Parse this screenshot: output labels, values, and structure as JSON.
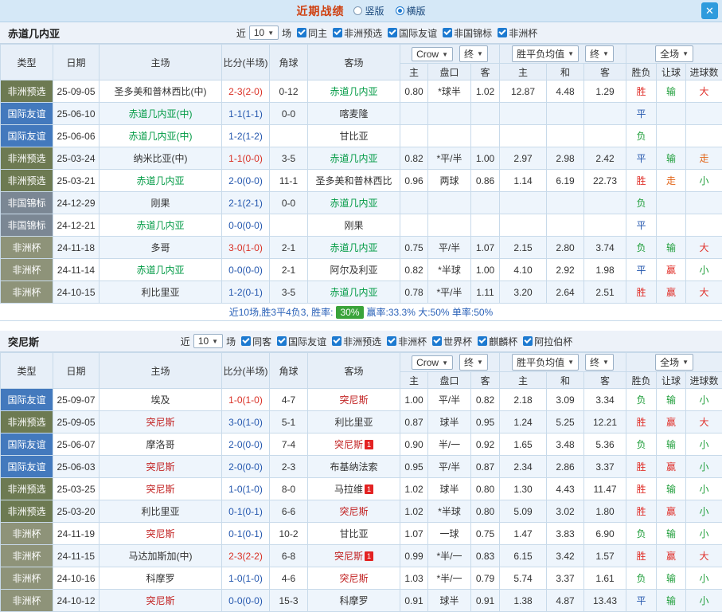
{
  "titlebar": {
    "title": "近期战绩",
    "radios": [
      {
        "label": "竖版",
        "selected": false
      },
      {
        "label": "横版",
        "selected": true
      }
    ],
    "close_icon": "✕"
  },
  "table_headers": {
    "type": "类型",
    "date": "日期",
    "home": "主场",
    "score": "比分(半场)",
    "corner": "角球",
    "away": "客场",
    "odds_sub": [
      "主",
      "盘口",
      "客"
    ],
    "avg_sub": [
      "主",
      "和",
      "客"
    ],
    "result_sub": [
      "胜负",
      "让球",
      "进球数"
    ]
  },
  "dropdowns": {
    "bookmaker": "Crow",
    "odds_final": "终",
    "avg": "胜平负均值",
    "avg_final": "终",
    "scope": "全场"
  },
  "type_colors": {
    "非洲预选": "#6d7a52",
    "国际友谊": "#4379bd",
    "非国锦标": "#7b8794",
    "非洲杯": "#8e9379"
  },
  "result_color_map": {
    "胜": "r",
    "平": "b",
    "负": "g",
    "赢": "r",
    "输": "g",
    "走": "o",
    "大": "r",
    "小": "g"
  },
  "colors": {
    "title_orange": "#cf4010",
    "accent_blue": "#1d7ad0",
    "summary_green": "#3aa33a",
    "focus_green": "#009a44",
    "focus_red": "#c22323",
    "header_bg": "#e7eff8",
    "alt_row_bg": "#eef5fc",
    "titlebar_bg": "#d5e8f7"
  },
  "sections": [
    {
      "team": "赤道几内亚",
      "team_color": "#009a44",
      "filters": {
        "recent": "近",
        "count": "10",
        "unit": "场",
        "checkboxes": [
          {
            "label": "同主",
            "checked": true
          },
          {
            "label": "非洲预选",
            "checked": true
          },
          {
            "label": "国际友谊",
            "checked": true
          },
          {
            "label": "非国锦标",
            "checked": true
          },
          {
            "label": "非洲杯",
            "checked": true
          }
        ]
      },
      "rows": [
        {
          "type": "非洲预选",
          "date": "25-09-05",
          "home": "圣多美和普林西比(中)",
          "home_focus": false,
          "score": "2-3(2-0)",
          "score_color": "red",
          "corner": "0-12",
          "away": "赤道几内亚",
          "away_focus": true,
          "odds": [
            "0.80",
            "*球半",
            "1.02"
          ],
          "avg": [
            "12.87",
            "4.48",
            "1.29"
          ],
          "res": [
            "胜",
            "输",
            "大"
          ]
        },
        {
          "type": "国际友谊",
          "date": "25-06-10",
          "home": "赤道几内亚(中)",
          "home_focus": true,
          "score": "1-1(1-1)",
          "score_color": "blue",
          "corner": "0-0",
          "away": "喀麦隆",
          "away_focus": false,
          "odds": null,
          "avg": null,
          "res": [
            "平",
            "",
            ""
          ]
        },
        {
          "type": "国际友谊",
          "date": "25-06-06",
          "home": "赤道几内亚(中)",
          "home_focus": true,
          "score": "1-2(1-2)",
          "score_color": "blue",
          "corner": "",
          "away": "甘比亚",
          "away_focus": false,
          "odds": null,
          "avg": null,
          "res": [
            "负",
            "",
            ""
          ]
        },
        {
          "type": "非洲预选",
          "date": "25-03-24",
          "home": "纳米比亚(中)",
          "home_focus": false,
          "score": "1-1(0-0)",
          "score_color": "red",
          "corner": "3-5",
          "away": "赤道几内亚",
          "away_focus": true,
          "odds": [
            "0.82",
            "*平/半",
            "1.00"
          ],
          "avg": [
            "2.97",
            "2.98",
            "2.42"
          ],
          "res": [
            "平",
            "输",
            "走"
          ]
        },
        {
          "type": "非洲预选",
          "date": "25-03-21",
          "home": "赤道几内亚",
          "home_focus": true,
          "score": "2-0(0-0)",
          "score_color": "blue",
          "corner": "11-1",
          "away": "圣多美和普林西比",
          "away_focus": false,
          "odds": [
            "0.96",
            "两球",
            "0.86"
          ],
          "avg": [
            "1.14",
            "6.19",
            "22.73"
          ],
          "res": [
            "胜",
            "走",
            "小"
          ]
        },
        {
          "type": "非国锦标",
          "date": "24-12-29",
          "home": "刚果",
          "home_focus": false,
          "score": "2-1(2-1)",
          "score_color": "blue",
          "corner": "0-0",
          "away": "赤道几内亚",
          "away_focus": true,
          "odds": null,
          "avg": null,
          "res": [
            "负",
            "",
            ""
          ]
        },
        {
          "type": "非国锦标",
          "date": "24-12-21",
          "home": "赤道几内亚",
          "home_focus": true,
          "score": "0-0(0-0)",
          "score_color": "blue",
          "corner": "",
          "away": "刚果",
          "away_focus": false,
          "odds": null,
          "avg": null,
          "res": [
            "平",
            "",
            ""
          ]
        },
        {
          "type": "非洲杯",
          "date": "24-11-18",
          "home": "多哥",
          "home_focus": false,
          "score": "3-0(1-0)",
          "score_color": "red",
          "corner": "2-1",
          "away": "赤道几内亚",
          "away_focus": true,
          "odds": [
            "0.75",
            "平/半",
            "1.07"
          ],
          "avg": [
            "2.15",
            "2.80",
            "3.74"
          ],
          "res": [
            "负",
            "输",
            "大"
          ]
        },
        {
          "type": "非洲杯",
          "date": "24-11-14",
          "home": "赤道几内亚",
          "home_focus": true,
          "score": "0-0(0-0)",
          "score_color": "blue",
          "corner": "2-1",
          "away": "阿尔及利亚",
          "away_focus": false,
          "odds": [
            "0.82",
            "*半球",
            "1.00"
          ],
          "avg": [
            "4.10",
            "2.92",
            "1.98"
          ],
          "res": [
            "平",
            "赢",
            "小"
          ]
        },
        {
          "type": "非洲杯",
          "date": "24-10-15",
          "home": "利比里亚",
          "home_focus": false,
          "score": "1-2(0-1)",
          "score_color": "blue",
          "corner": "3-5",
          "away": "赤道几内亚",
          "away_focus": true,
          "odds": [
            "0.78",
            "*平/半",
            "1.11"
          ],
          "avg": [
            "3.20",
            "2.64",
            "2.51"
          ],
          "res": [
            "胜",
            "赢",
            "大"
          ]
        }
      ],
      "summary": {
        "record": "近10场,胜3平4负3, 胜率:",
        "win_rate": "30%",
        "rates": "赢率:33.3% 大:50% 单率:50%"
      }
    },
    {
      "team": "突尼斯",
      "team_color": "#c22323",
      "filters": {
        "recent": "近",
        "count": "10",
        "unit": "场",
        "checkboxes": [
          {
            "label": "同客",
            "checked": true
          },
          {
            "label": "国际友谊",
            "checked": true
          },
          {
            "label": "非洲预选",
            "checked": true
          },
          {
            "label": "非洲杯",
            "checked": true
          },
          {
            "label": "世界杯",
            "checked": true
          },
          {
            "label": "麒麟杯",
            "checked": true
          },
          {
            "label": "阿拉伯杯",
            "checked": true
          }
        ]
      },
      "rows": [
        {
          "type": "国际友谊",
          "date": "25-09-07",
          "home": "埃及",
          "home_focus": false,
          "score": "1-0(1-0)",
          "score_color": "red",
          "corner": "4-7",
          "away": "突尼斯",
          "away_focus": true,
          "odds": [
            "1.00",
            "平/半",
            "0.82"
          ],
          "avg": [
            "2.18",
            "3.09",
            "3.34"
          ],
          "res": [
            "负",
            "输",
            "小"
          ]
        },
        {
          "type": "非洲预选",
          "date": "25-09-05",
          "home": "突尼斯",
          "home_focus": true,
          "score": "3-0(1-0)",
          "score_color": "blue",
          "corner": "5-1",
          "away": "利比里亚",
          "away_focus": false,
          "odds": [
            "0.87",
            "球半",
            "0.95"
          ],
          "avg": [
            "1.24",
            "5.25",
            "12.21"
          ],
          "res": [
            "胜",
            "赢",
            "大"
          ]
        },
        {
          "type": "国际友谊",
          "date": "25-06-07",
          "home": "摩洛哥",
          "home_focus": false,
          "score": "2-0(0-0)",
          "score_color": "blue",
          "corner": "7-4",
          "away": "突尼斯",
          "away_focus": true,
          "away_badge": "1",
          "odds": [
            "0.90",
            "半/一",
            "0.92"
          ],
          "avg": [
            "1.65",
            "3.48",
            "5.36"
          ],
          "res": [
            "负",
            "输",
            "小"
          ]
        },
        {
          "type": "国际友谊",
          "date": "25-06-03",
          "home": "突尼斯",
          "home_focus": true,
          "score": "2-0(0-0)",
          "score_color": "blue",
          "corner": "2-3",
          "away": "布基纳法索",
          "away_focus": false,
          "odds": [
            "0.95",
            "平/半",
            "0.87"
          ],
          "avg": [
            "2.34",
            "2.86",
            "3.37"
          ],
          "res": [
            "胜",
            "赢",
            "小"
          ]
        },
        {
          "type": "非洲预选",
          "date": "25-03-25",
          "home": "突尼斯",
          "home_focus": true,
          "score": "1-0(1-0)",
          "score_color": "blue",
          "corner": "8-0",
          "away": "马拉维",
          "away_focus": false,
          "away_badge": "1",
          "odds": [
            "1.02",
            "球半",
            "0.80"
          ],
          "avg": [
            "1.30",
            "4.43",
            "11.47"
          ],
          "res": [
            "胜",
            "输",
            "小"
          ]
        },
        {
          "type": "非洲预选",
          "date": "25-03-20",
          "home": "利比里亚",
          "home_focus": false,
          "score": "0-1(0-1)",
          "score_color": "blue",
          "corner": "6-6",
          "away": "突尼斯",
          "away_focus": true,
          "odds": [
            "1.02",
            "*半球",
            "0.80"
          ],
          "avg": [
            "5.09",
            "3.02",
            "1.80"
          ],
          "res": [
            "胜",
            "赢",
            "小"
          ]
        },
        {
          "type": "非洲杯",
          "date": "24-11-19",
          "home": "突尼斯",
          "home_focus": true,
          "score": "0-1(0-1)",
          "score_color": "blue",
          "corner": "10-2",
          "away": "甘比亚",
          "away_focus": false,
          "odds": [
            "1.07",
            "一球",
            "0.75"
          ],
          "avg": [
            "1.47",
            "3.83",
            "6.90"
          ],
          "res": [
            "负",
            "输",
            "小"
          ]
        },
        {
          "type": "非洲杯",
          "date": "24-11-15",
          "home": "马达加斯加(中)",
          "home_focus": false,
          "score": "2-3(2-2)",
          "score_color": "red",
          "corner": "6-8",
          "away": "突尼斯",
          "away_focus": true,
          "away_badge": "1",
          "odds": [
            "0.99",
            "*半/一",
            "0.83"
          ],
          "avg": [
            "6.15",
            "3.42",
            "1.57"
          ],
          "res": [
            "胜",
            "赢",
            "大"
          ]
        },
        {
          "type": "非洲杯",
          "date": "24-10-16",
          "home": "科摩罗",
          "home_focus": false,
          "score": "1-0(1-0)",
          "score_color": "blue",
          "corner": "4-6",
          "away": "突尼斯",
          "away_focus": true,
          "odds": [
            "1.03",
            "*半/一",
            "0.79"
          ],
          "avg": [
            "5.74",
            "3.37",
            "1.61"
          ],
          "res": [
            "负",
            "输",
            "小"
          ]
        },
        {
          "type": "非洲杯",
          "date": "24-10-12",
          "home": "突尼斯",
          "home_focus": true,
          "score": "0-0(0-0)",
          "score_color": "blue",
          "corner": "15-3",
          "away": "科摩罗",
          "away_focus": false,
          "odds": [
            "0.91",
            "球半",
            "0.91"
          ],
          "avg": [
            "1.38",
            "4.87",
            "13.43"
          ],
          "res": [
            "平",
            "输",
            "小"
          ]
        }
      ],
      "summary": null
    }
  ]
}
